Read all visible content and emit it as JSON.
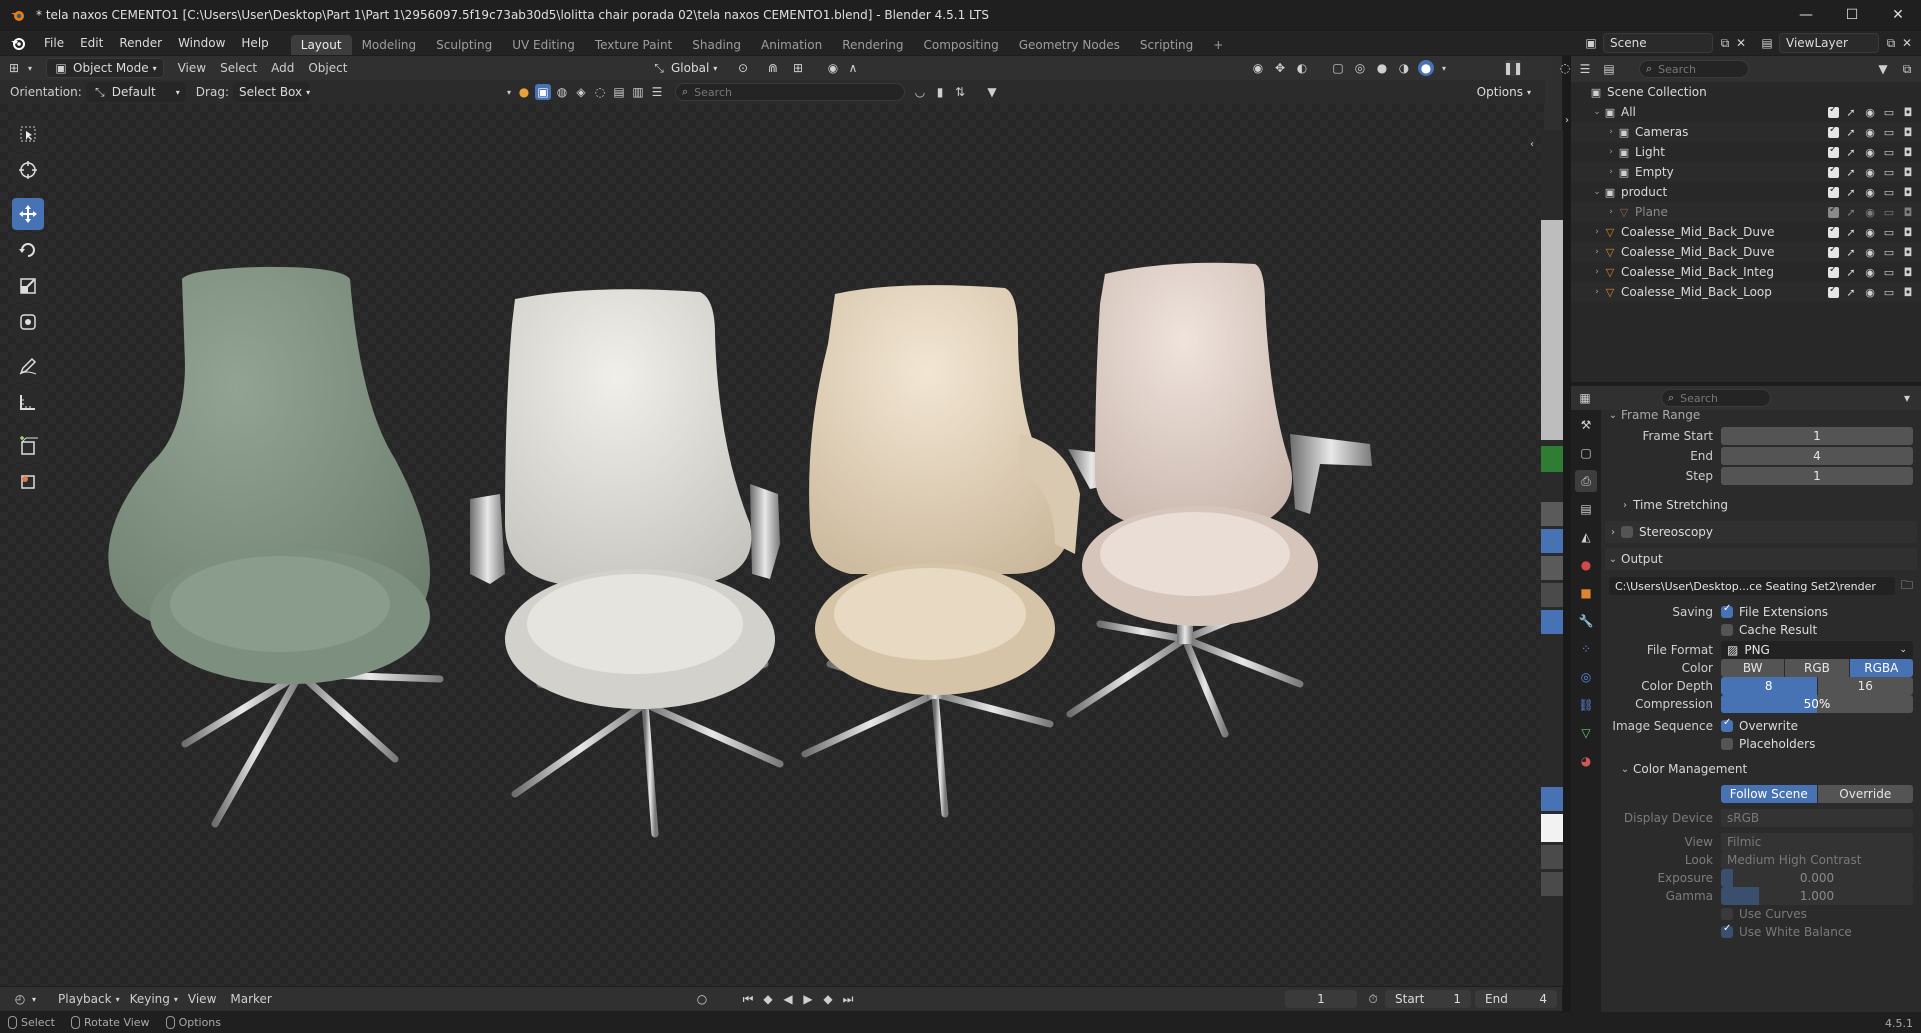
{
  "window": {
    "title": "* tela naxos CEMENTO1 [C:\\Users\\User\\Desktop\\Part 1\\Part 1\\2956097.5f19c73ab30d5\\lolitta chair porada 02\\tela naxos CEMENTO1.blend] - Blender 4.5.1 LTS",
    "minimize": "—",
    "maximize": "☐",
    "close": "✕"
  },
  "menu": [
    "File",
    "Edit",
    "Render",
    "Window",
    "Help"
  ],
  "workspaces": [
    "Layout",
    "Modeling",
    "Sculpting",
    "UV Editing",
    "Texture Paint",
    "Shading",
    "Animation",
    "Rendering",
    "Compositing",
    "Geometry Nodes",
    "Scripting"
  ],
  "workspace_add": "+",
  "scene": {
    "name": "Scene",
    "view_layer": "ViewLayer"
  },
  "viewport": {
    "mode": "Object Mode",
    "menus": [
      "View",
      "Select",
      "Add",
      "Object"
    ],
    "transform_orientation": "Global",
    "orientation_label": "Orientation:",
    "orientation_value": "Default",
    "drag_label": "Drag:",
    "drag_value": "Select Box",
    "search_placeholder": "Search",
    "options_label": "Options"
  },
  "chairs": [
    {
      "name": "green-fabric-chair",
      "shell": "#8b9c8c",
      "seat": "#7f917f"
    },
    {
      "name": "white-leather-chair",
      "shell": "#e4e2dd",
      "seat": "#dddbd5"
    },
    {
      "name": "beige-suede-chair",
      "shell": "#eadcc6",
      "seat": "#e0cfb5"
    },
    {
      "name": "blush-leather-chair",
      "shell": "#e7d9d1",
      "seat": "#e0d0c6"
    }
  ],
  "outliner": {
    "search_placeholder": "Search",
    "scene_collection": "Scene Collection",
    "rows": [
      {
        "label": "All",
        "indent": 1,
        "expanded": true
      },
      {
        "label": "Cameras",
        "indent": 2,
        "expanded": false
      },
      {
        "label": "Light",
        "indent": 2,
        "expanded": false
      },
      {
        "label": "Empty",
        "indent": 2,
        "expanded": false
      },
      {
        "label": "product",
        "indent": 1,
        "expanded": true
      },
      {
        "label": "Plane",
        "indent": 2,
        "expanded": false,
        "dim": true
      },
      {
        "label": "Coalesse_Mid_Back_Duve",
        "indent": 1,
        "expanded": false
      },
      {
        "label": "Coalesse_Mid_Back_Duve",
        "indent": 1,
        "expanded": false
      },
      {
        "label": "Coalesse_Mid_Back_Integ",
        "indent": 1,
        "expanded": false
      },
      {
        "label": "Coalesse_Mid_Back_Loop",
        "indent": 1,
        "expanded": false
      }
    ]
  },
  "properties": {
    "search_placeholder": "Search",
    "frame_range_title": "Frame Range",
    "frame_start_label": "Frame Start",
    "frame_start": "1",
    "end_label": "End",
    "end": "4",
    "step_label": "Step",
    "step": "1",
    "time_stretching": "Time Stretching",
    "stereoscopy": "Stereoscopy",
    "output_title": "Output",
    "output_path": "C:\\Users\\User\\Desktop...ce Seating Set2\\render",
    "saving_label": "Saving",
    "file_extensions": "File Extensions",
    "cache_result": "Cache Result",
    "file_format_label": "File Format",
    "file_format": "PNG",
    "color_label": "Color",
    "color_options": [
      "BW",
      "RGB",
      "RGBA"
    ],
    "color_selected": "RGBA",
    "color_depth_label": "Color Depth",
    "color_depth_options": [
      "8",
      "16"
    ],
    "color_depth_selected": "8",
    "compression_label": "Compression",
    "compression": "50%",
    "compression_value": 0.5,
    "image_sequence_label": "Image Sequence",
    "overwrite": "Overwrite",
    "placeholders": "Placeholders",
    "color_management_title": "Color Management",
    "cm_options": [
      "Follow Scene",
      "Override"
    ],
    "cm_selected": "Follow Scene",
    "display_device_label": "Display Device",
    "display_device": "sRGB",
    "view_label": "View",
    "view": "Filmic",
    "look_label": "Look",
    "look": "Medium High Contrast",
    "exposure_label": "Exposure",
    "exposure": "0.000",
    "gamma_label": "Gamma",
    "gamma": "1.000",
    "use_curves": "Use Curves",
    "use_white_balance": "Use White Balance"
  },
  "timeline": {
    "menus": [
      "Playback",
      "Keying",
      "View",
      "Marker"
    ],
    "current_frame": "1",
    "start_label": "Start",
    "start": "1",
    "end_label": "End",
    "end": "4"
  },
  "statusbar": {
    "items": [
      "Select",
      "Rotate View",
      "Options"
    ],
    "version": "4.5.1"
  },
  "colors": {
    "accent": "#4772b3",
    "background": "#1d1d1d",
    "viewport": "#2f2f2f"
  }
}
